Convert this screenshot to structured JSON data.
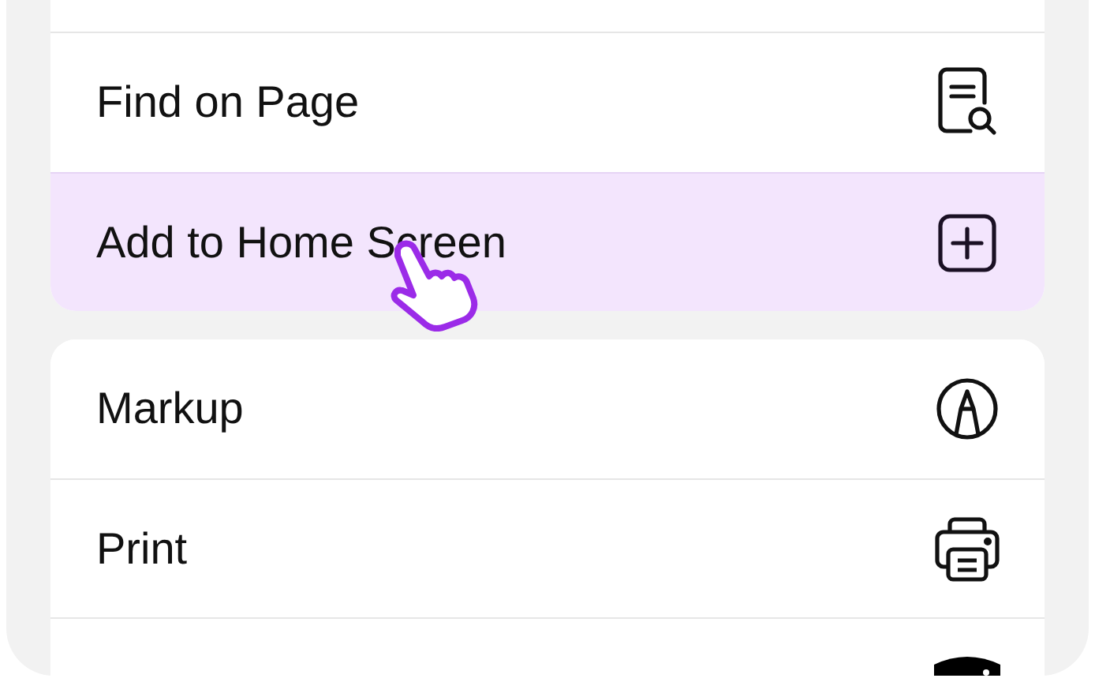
{
  "groups": [
    {
      "rows": [
        {
          "label": "Find on Page",
          "kind": "find",
          "selected": false
        },
        {
          "label": "Add to Home Screen",
          "kind": "add",
          "selected": true
        }
      ]
    },
    {
      "rows": [
        {
          "label": "Markup",
          "kind": "markup",
          "selected": false
        },
        {
          "label": "Print",
          "kind": "print",
          "selected": false
        },
        {
          "kind": "app",
          "selected": false
        }
      ]
    }
  ]
}
